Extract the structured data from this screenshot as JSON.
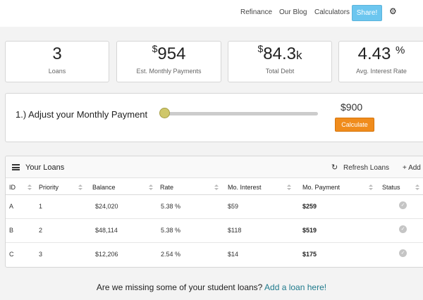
{
  "nav": {
    "links": [
      "Refinance",
      "Our Blog",
      "Calculators"
    ],
    "share_label": "Share!",
    "settings_icon": "gear-icon"
  },
  "stats": {
    "loans": {
      "value": "3",
      "label": "Loans"
    },
    "monthly": {
      "currency": "$",
      "value": "954",
      "label": "Est. Monthly Payments"
    },
    "debt": {
      "currency": "$",
      "value": "84.3",
      "unit": "k",
      "label": "Total Debt"
    },
    "rate": {
      "value": "4.43",
      "unit": "%",
      "label": "Avg. Interest Rate"
    }
  },
  "adjust": {
    "title": "1.) Adjust your Monthly Payment",
    "amount": "$900",
    "calculate_label": "Calculate",
    "slider_level": 0
  },
  "loans": {
    "title": "Your Loans",
    "refresh_label": "Refresh Loans",
    "add_label": "+ Add a",
    "columns": [
      "ID",
      "Priority",
      "Balance",
      "Rate",
      "Mo. Interest",
      "Mo. Payment",
      "Status"
    ],
    "rows": [
      {
        "id": "A",
        "priority": "1",
        "balance": "$24,020",
        "rate": "5.38 %",
        "interest": "$59",
        "payment": "$259",
        "status": "check"
      },
      {
        "id": "B",
        "priority": "2",
        "balance": "$48,114",
        "rate": "5.38 %",
        "interest": "$118",
        "payment": "$519",
        "status": "check"
      },
      {
        "id": "C",
        "priority": "3",
        "balance": "$12,206",
        "rate": "2.54 %",
        "interest": "$14",
        "payment": "$175",
        "status": "check"
      }
    ]
  },
  "footer": {
    "question": "Are we missing some of your student loans?",
    "link": "Add a loan here!"
  },
  "colors": {
    "share": "#6cc6ef",
    "calculate": "#f08c1c",
    "slider_thumb": "#cfc76a",
    "link": "#1f7a8c"
  }
}
